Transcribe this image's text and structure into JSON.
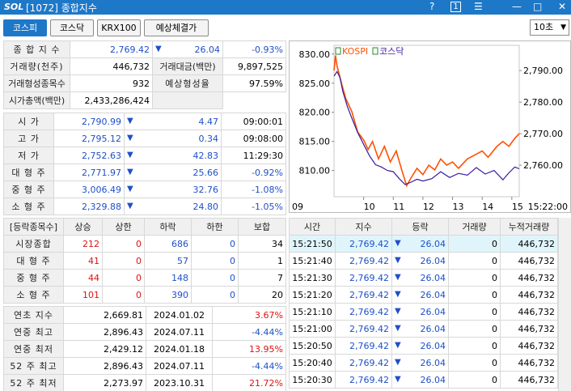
{
  "titlebar": {
    "logo": "SOL",
    "title": "[1072] 종합지수",
    "help": "?",
    "box_number": "1",
    "menu": "☰",
    "minimize": "—",
    "maximize": "□",
    "close": "✕"
  },
  "tabs": [
    "코스피",
    "코스닥",
    "KRX100",
    "예상체결가"
  ],
  "count_select": "10초",
  "summary": {
    "row1": {
      "label": "종 합 지 수",
      "value": "2,769.42",
      "change": "26.04",
      "rate": "-0.93%"
    },
    "row2": {
      "label1": "거래량(천주)",
      "value1": "446,732",
      "label2": "거래대금(백만)",
      "value2": "9,897,525"
    },
    "row3": {
      "label1": "거래형성종목수",
      "value1": "932",
      "label2": "예상형성율",
      "value2": "97.59%"
    },
    "row4": {
      "label1": "시가총액(백만)",
      "value1": "2,433,286,424"
    }
  },
  "ohlc": [
    {
      "label": "시 가",
      "value": "2,790.99",
      "change": "4.47",
      "extra": "09:00:01",
      "extra_color": "black"
    },
    {
      "label": "고 가",
      "value": "2,795.12",
      "change": "0.34",
      "extra": "09:08:00",
      "extra_color": "black"
    },
    {
      "label": "저 가",
      "value": "2,752.63",
      "change": "42.83",
      "extra": "11:29:30",
      "extra_color": "black"
    },
    {
      "label": "대 형 주",
      "value": "2,771.97",
      "change": "25.66",
      "extra": "-0.92%",
      "extra_color": "blue"
    },
    {
      "label": "중 형 주",
      "value": "3,006.49",
      "change": "32.76",
      "extra": "-1.08%",
      "extra_color": "blue"
    },
    {
      "label": "소 형 주",
      "value": "2,329.88",
      "change": "24.80",
      "extra": "-1.05%",
      "extra_color": "blue"
    }
  ],
  "breadth": {
    "headers": [
      "[등락종목수]",
      "상승",
      "상한",
      "하락",
      "하한",
      "보합"
    ],
    "rows": [
      {
        "label": "시장종합",
        "up": "212",
        "upper": "0",
        "down": "686",
        "lower": "0",
        "flat": "34"
      },
      {
        "label": "대 형 주",
        "up": "41",
        "upper": "0",
        "down": "57",
        "lower": "0",
        "flat": "1"
      },
      {
        "label": "중 형 주",
        "up": "44",
        "upper": "0",
        "down": "148",
        "lower": "0",
        "flat": "7"
      },
      {
        "label": "소 형 주",
        "up": "101",
        "upper": "0",
        "down": "390",
        "lower": "0",
        "flat": "20"
      }
    ]
  },
  "yearly": [
    {
      "label": "연초 지수",
      "value": "2,669.81",
      "date": "2024.01.02",
      "rate": "3.67%",
      "rate_color": "red"
    },
    {
      "label": "연중 최고",
      "value": "2,896.43",
      "date": "2024.07.11",
      "rate": "-4.44%",
      "rate_color": "blue"
    },
    {
      "label": "연중 최저",
      "value": "2,429.12",
      "date": "2024.01.18",
      "rate": "13.95%",
      "rate_color": "red"
    },
    {
      "label": "52 주 최고",
      "value": "2,896.43",
      "date": "2024.07.11",
      "rate": "-4.44%",
      "rate_color": "blue"
    },
    {
      "label": "52 주 최저",
      "value": "2,273.97",
      "date": "2023.10.31",
      "rate": "21.72%",
      "rate_color": "red"
    }
  ],
  "ticks": {
    "headers": [
      "시간",
      "지수",
      "등락",
      "거래량",
      "누적거래량"
    ],
    "rows": [
      {
        "time": "15:21:50",
        "index": "2,769.42",
        "change": "26.04",
        "volume": "0",
        "cum": "446,732"
      },
      {
        "time": "15:21:40",
        "index": "2,769.42",
        "change": "26.04",
        "volume": "0",
        "cum": "446,732"
      },
      {
        "time": "15:21:30",
        "index": "2,769.42",
        "change": "26.04",
        "volume": "0",
        "cum": "446,732"
      },
      {
        "time": "15:21:20",
        "index": "2,769.42",
        "change": "26.04",
        "volume": "0",
        "cum": "446,732"
      },
      {
        "time": "15:21:10",
        "index": "2,769.42",
        "change": "26.04",
        "volume": "0",
        "cum": "446,732"
      },
      {
        "time": "15:21:00",
        "index": "2,769.42",
        "change": "26.04",
        "volume": "0",
        "cum": "446,732"
      },
      {
        "time": "15:20:50",
        "index": "2,769.42",
        "change": "26.04",
        "volume": "0",
        "cum": "446,732"
      },
      {
        "time": "15:20:40",
        "index": "2,769.42",
        "change": "26.04",
        "volume": "0",
        "cum": "446,732"
      },
      {
        "time": "15:20:30",
        "index": "2,769.42",
        "change": "26.04",
        "volume": "0",
        "cum": "446,732"
      }
    ]
  },
  "chart_data": {
    "type": "line",
    "legend": [
      "KOSPI",
      "코스닥"
    ],
    "colors": {
      "kospi": "#ff5000",
      "kosdaq": "#3a1aa0"
    },
    "left_axis": {
      "ticks": [
        "830.00",
        "825.00",
        "820.00",
        "815.00",
        "810.00"
      ],
      "range": [
        805.5,
        831.5
      ]
    },
    "right_axis": {
      "ticks": [
        "2,790.00",
        "2,780.00",
        "2,770.00",
        "2,760.00"
      ],
      "range": [
        2750.0,
        2798.0
      ]
    },
    "x_ticks": [
      "09",
      "10",
      "11",
      "12",
      "13",
      "14",
      "15",
      "15:22:00"
    ],
    "kosdaq_series": [
      [
        9.0,
        826.2
      ],
      [
        9.1,
        827.0
      ],
      [
        9.2,
        826.0
      ],
      [
        9.3,
        823.5
      ],
      [
        9.45,
        821.0
      ],
      [
        9.6,
        819.0
      ],
      [
        9.8,
        816.5
      ],
      [
        10.0,
        814.5
      ],
      [
        10.2,
        812.5
      ],
      [
        10.4,
        811.0
      ],
      [
        10.6,
        810.6
      ],
      [
        10.8,
        810.0
      ],
      [
        11.0,
        809.8
      ],
      [
        11.2,
        808.6
      ],
      [
        11.4,
        807.6
      ],
      [
        11.6,
        808.0
      ],
      [
        11.8,
        808.5
      ],
      [
        12.0,
        808.2
      ],
      [
        12.3,
        808.6
      ],
      [
        12.6,
        809.8
      ],
      [
        12.9,
        808.8
      ],
      [
        13.2,
        809.5
      ],
      [
        13.5,
        809.2
      ],
      [
        13.8,
        810.5
      ],
      [
        14.1,
        809.4
      ],
      [
        14.4,
        810.0
      ],
      [
        14.7,
        808.4
      ],
      [
        14.9,
        809.6
      ],
      [
        15.1,
        810.6
      ],
      [
        15.25,
        810.3
      ]
    ],
    "kospi_series": [
      [
        9.0,
        2790.0
      ],
      [
        9.05,
        2794.8
      ],
      [
        9.1,
        2791.5
      ],
      [
        9.25,
        2786.0
      ],
      [
        9.4,
        2781.0
      ],
      [
        9.6,
        2777.0
      ],
      [
        9.8,
        2770.5
      ],
      [
        10.0,
        2768.0
      ],
      [
        10.15,
        2765.0
      ],
      [
        10.3,
        2767.5
      ],
      [
        10.5,
        2762.0
      ],
      [
        10.7,
        2766.0
      ],
      [
        10.9,
        2761.0
      ],
      [
        11.1,
        2764.5
      ],
      [
        11.3,
        2758.0
      ],
      [
        11.45,
        2753.5
      ],
      [
        11.6,
        2756.0
      ],
      [
        11.8,
        2759.0
      ],
      [
        12.0,
        2757.0
      ],
      [
        12.2,
        2760.0
      ],
      [
        12.4,
        2758.5
      ],
      [
        12.6,
        2762.0
      ],
      [
        12.8,
        2760.0
      ],
      [
        13.0,
        2761.0
      ],
      [
        13.2,
        2759.0
      ],
      [
        13.5,
        2762.0
      ],
      [
        13.8,
        2763.5
      ],
      [
        14.0,
        2764.5
      ],
      [
        14.2,
        2762.5
      ],
      [
        14.5,
        2766.0
      ],
      [
        14.7,
        2767.5
      ],
      [
        14.9,
        2766.0
      ],
      [
        15.1,
        2768.5
      ],
      [
        15.25,
        2770.0
      ]
    ]
  }
}
